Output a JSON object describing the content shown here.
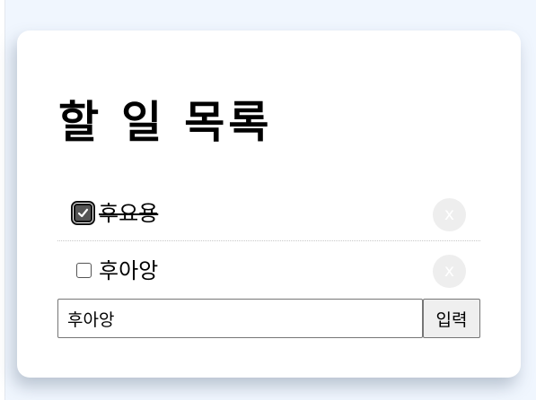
{
  "app": {
    "title": "할 일 목록"
  },
  "todos": [
    {
      "text": "후요용",
      "done": true,
      "delete_label": "x"
    },
    {
      "text": "후아앙",
      "done": false,
      "delete_label": "x"
    }
  ],
  "input": {
    "value": "후아앙",
    "submit_label": "입력"
  },
  "colors": {
    "background": "#f0f6fe",
    "card": "#ffffff",
    "delete_button": "#eeeeee",
    "submit_button": "#efefef"
  }
}
